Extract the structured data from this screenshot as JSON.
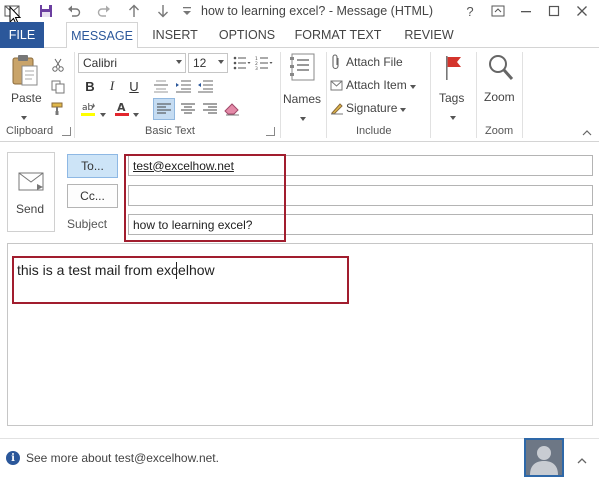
{
  "window": {
    "title": "how to learning excel? - Message (HTML)",
    "help": "?",
    "restore": "❐",
    "minimize": "—",
    "maximize": "□",
    "close": "✕"
  },
  "tabs": {
    "file": "FILE",
    "items": [
      "MESSAGE",
      "INSERT",
      "OPTIONS",
      "FORMAT TEXT",
      "REVIEW"
    ],
    "active": "MESSAGE"
  },
  "ribbon": {
    "clipboard": {
      "paste": "Paste",
      "label": "Clipboard"
    },
    "basic_text": {
      "font": "Calibri",
      "size": "12",
      "bold": "B",
      "italic": "I",
      "underline": "U",
      "label": "Basic Text"
    },
    "names": {
      "label": "Names"
    },
    "include": {
      "attach_file": "Attach File",
      "attach_item": "Attach Item",
      "signature": "Signature",
      "label": "Include"
    },
    "tags": {
      "label": "Tags"
    },
    "zoom": {
      "zoom_btn": "Zoom",
      "label": "Zoom"
    }
  },
  "message": {
    "send": "Send",
    "to_button": "To...",
    "cc_button": "Cc...",
    "subject_label": "Subject",
    "to_value": "test@excelhow.net",
    "cc_value": "",
    "subject_value": "how to learning excel?",
    "body": "this is a test mail from excelhow"
  },
  "footer": {
    "info": "See more about test@excelhow.net."
  },
  "colors": {
    "file_tab": "#2b579a",
    "active_tab_text": "#2b579a",
    "highlight_box": "#a11d2e",
    "to_button_bg": "#cde4f7"
  }
}
